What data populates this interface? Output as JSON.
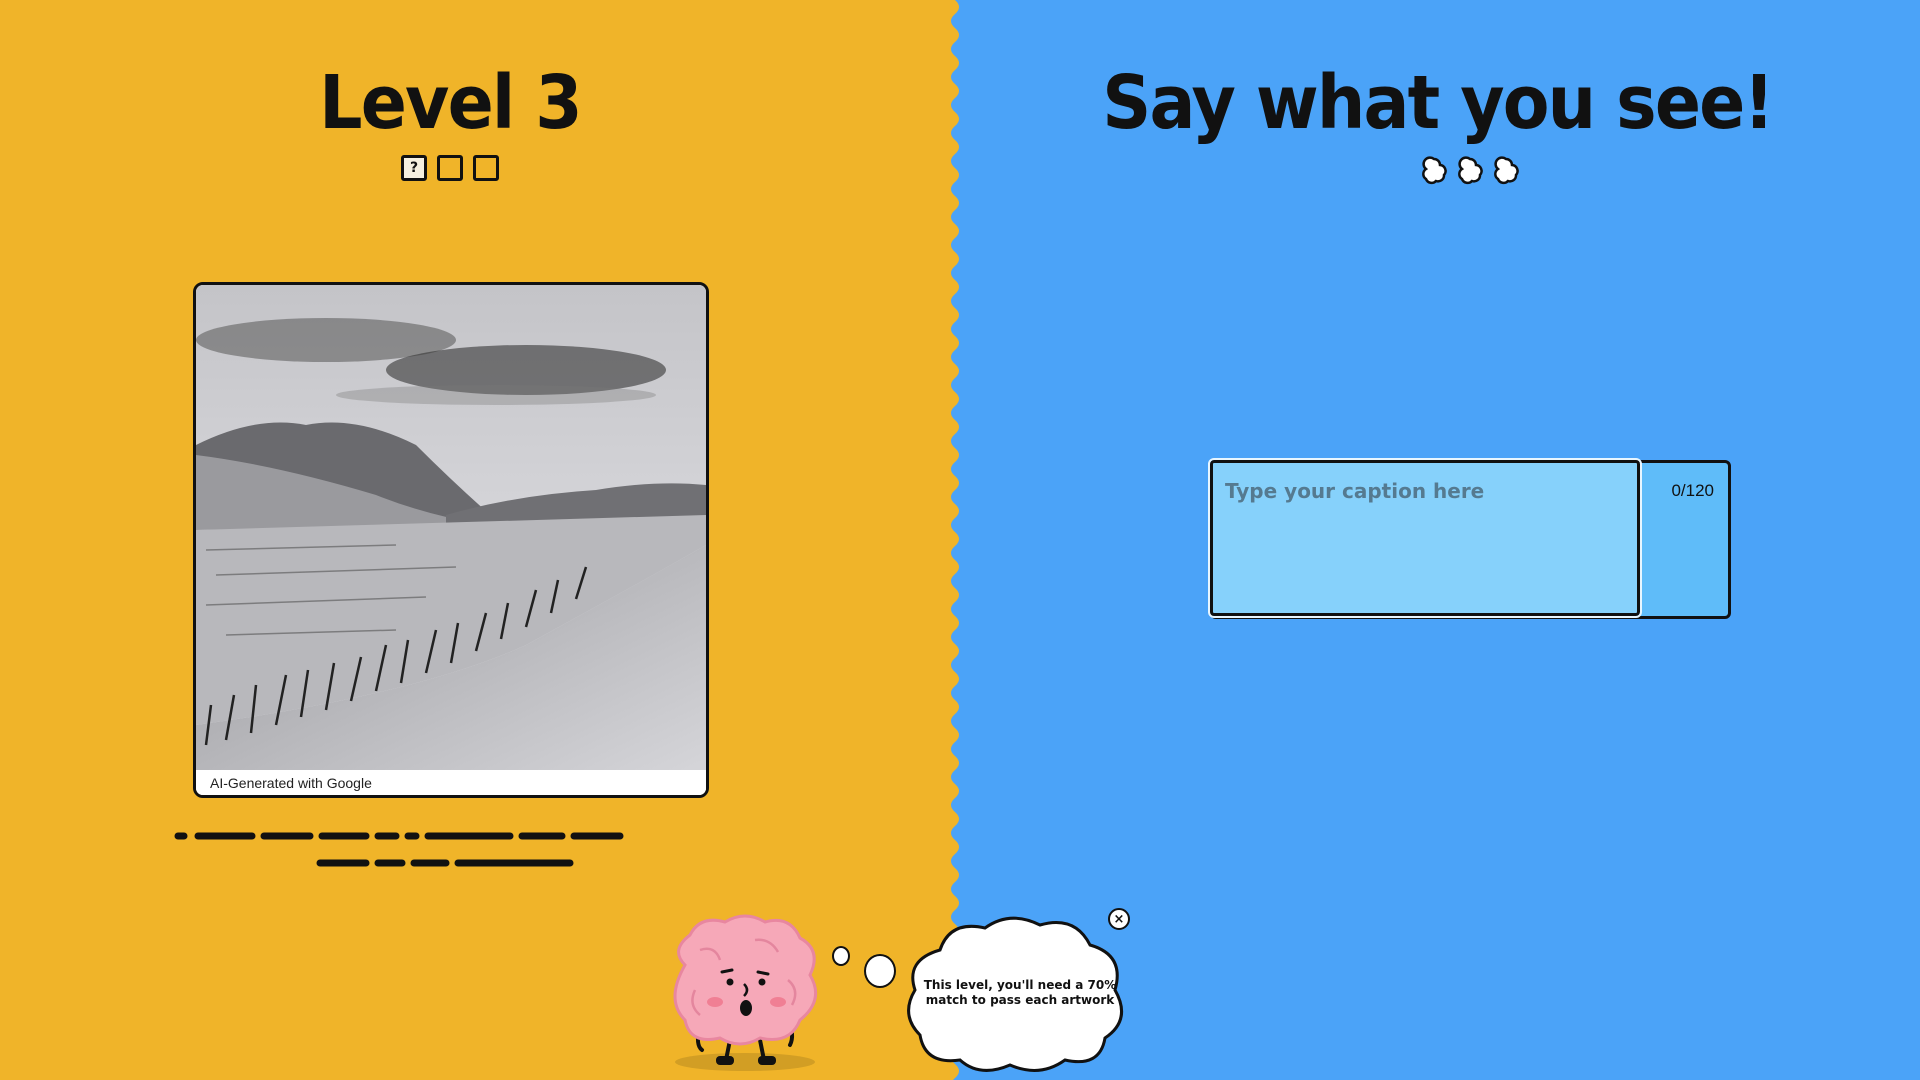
{
  "level": {
    "title": "Level 3",
    "progress_boxes": [
      {
        "state": "current",
        "symbol": "?"
      },
      {
        "state": "empty",
        "symbol": ""
      },
      {
        "state": "empty",
        "symbol": ""
      }
    ]
  },
  "artwork": {
    "credit": "AI-Generated with Google",
    "hidden_caption_scribbled": true
  },
  "prompt": {
    "title": "Say what you see!",
    "lives": 3
  },
  "caption": {
    "placeholder": "Type your caption here",
    "value": "",
    "count": "0/120"
  },
  "hint": {
    "text": "This level, you'll need a 70% match to pass each artwork",
    "close_icon": "close-icon"
  },
  "colors": {
    "left_bg": "#f0b429",
    "right_bg": "#4ba3f8",
    "caption_field": "#86d1fb"
  }
}
